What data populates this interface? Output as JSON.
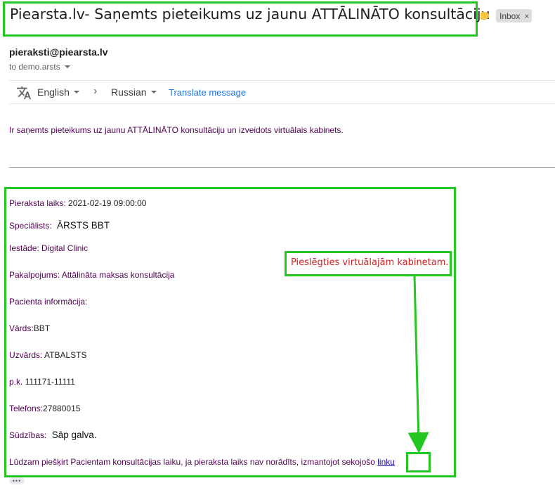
{
  "email": {
    "subject": "Piearsta.lv- Saņemts pieteikums uz jaunu ATTĀLINĀTO konsultāciju",
    "inbox_label": "Inbox",
    "inbox_close": "×",
    "sender": "pieraksti@piearsta.lv",
    "to_line": "to demo.arsts"
  },
  "translate": {
    "from_lang": "English",
    "arrow": "›",
    "to_lang": "Russian",
    "action": "Translate message"
  },
  "body": {
    "intro": "Ir saņemts pieteikums uz jaunu ATTĀLINĀTO konsultāciju un izveidots virtuālais kabinets.",
    "time_label": "Pieraksta laiks:",
    "time_value": "2021-02-19 09:00:00",
    "specialist_label": "Speciālists:",
    "specialist_value": "ĀRSTS BBT",
    "institution_label": "Iestāde:",
    "institution_value": "Digital Clinic",
    "service_label": "Pakalpojums:",
    "service_value": "Attālināta maksas konsultācija",
    "patient_info": "Pacienta informācija:",
    "name_label": "Vārds:",
    "name_value": "BBT",
    "surname_label": "Uzvārds:",
    "surname_value": "ATBALSTS",
    "pk_label": "p.k.",
    "pk_value": "111171-11111",
    "phone_label": "Telefons:",
    "phone_value": "27880015",
    "complaints_label": "Sūdzības:",
    "complaints_value": "Sāp galva.",
    "request_text": "Lūdzam piešķirt Pacientam konsultācijas laiku, ja pieraksta laiks nav norādīts, izmantojot sekojošo",
    "link_text": "linku"
  },
  "annotation": {
    "callout": "Pieslēgties virtuālajām kabinetam."
  },
  "colors": {
    "highlight": "#22c722",
    "annotation_text": "#d02020",
    "label_text": "#500050",
    "link": "#1a0dab"
  },
  "icons": [
    "translate-icon",
    "close-icon",
    "chevron-down-icon",
    "chevron-right-icon",
    "label-tag-icon",
    "more-icon"
  ]
}
